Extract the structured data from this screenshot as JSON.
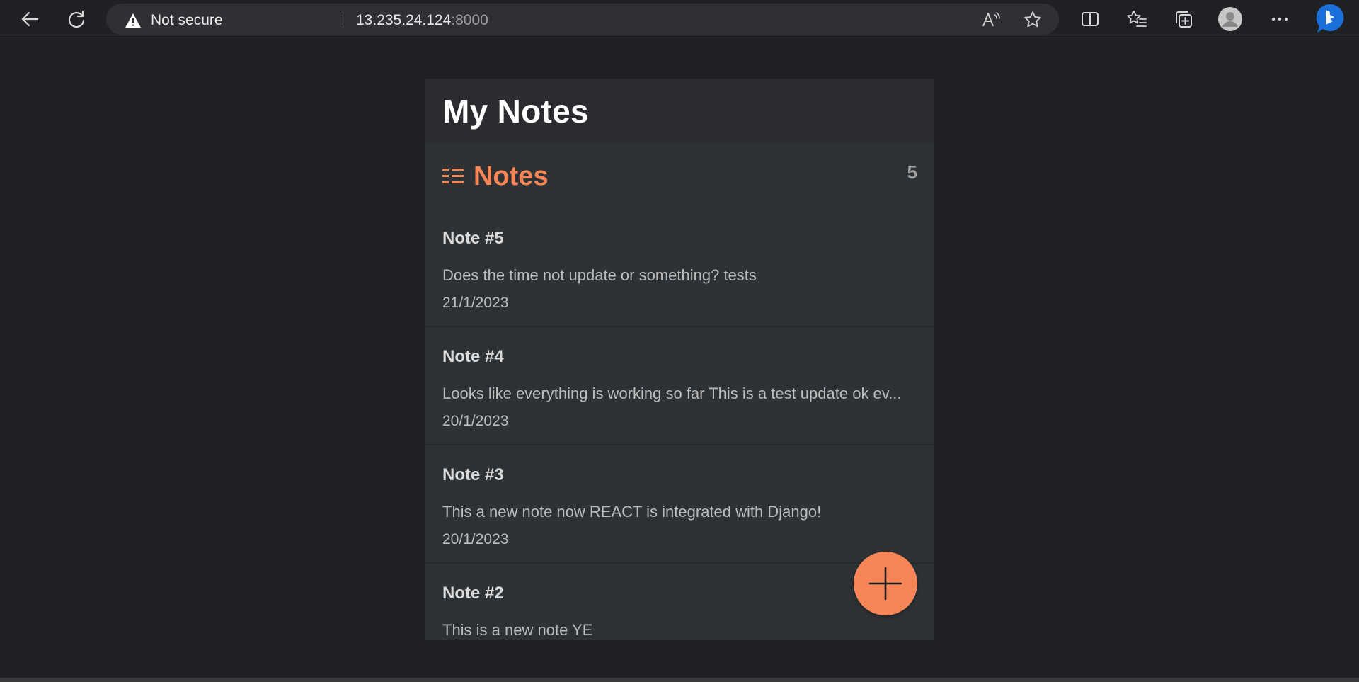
{
  "browser": {
    "security_text": "Not secure",
    "url_host": "13.235.24.124",
    "url_port": ":8000"
  },
  "app": {
    "title": "My Notes",
    "section_title": "Notes",
    "count": "5",
    "accent_color": "#f68657"
  },
  "notes": [
    {
      "title": "Note #5",
      "body": "Does the time not update or something? tests",
      "date": "21/1/2023"
    },
    {
      "title": "Note #4",
      "body": "Looks like everything is working so far This is a test update ok ev...",
      "date": "20/1/2023"
    },
    {
      "title": "Note #3",
      "body": "This a new note now REACT is integrated with Django!",
      "date": "20/1/2023"
    },
    {
      "title": "Note #2",
      "body": "This is a new note YE",
      "date": ""
    }
  ]
}
